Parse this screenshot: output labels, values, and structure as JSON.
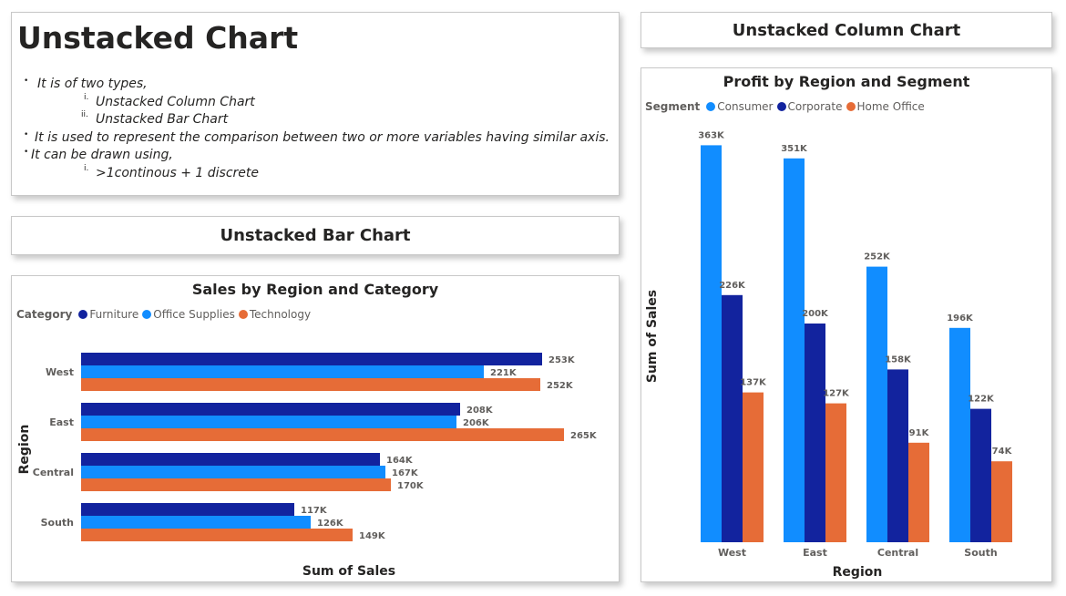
{
  "notes": {
    "title": "Unstacked Chart",
    "lines": [
      {
        "marker": "•",
        "text": "It is of two types,"
      },
      {
        "marker": "i.",
        "text": "Unstacked Column Chart"
      },
      {
        "marker": "ii.",
        "text": "Unstacked Bar Chart"
      },
      {
        "marker": "•",
        "text": "It is used to represent the comparison between two or more variables having similar axis."
      },
      {
        "marker": "•",
        "text": "It can be drawn using,"
      },
      {
        "marker": "i.",
        "text": ">1continous + 1 discrete"
      }
    ]
  },
  "bar_section_title": "Unstacked Bar Chart",
  "column_section_title": "Unstacked Column Chart",
  "colors": {
    "dark_blue": "#12239e",
    "light_blue": "#118dff",
    "orange": "#e66c37"
  },
  "chart_data": [
    {
      "type": "bar",
      "orientation": "horizontal",
      "title": "Sales by Region and Category",
      "legend_title": "Category",
      "legend_position": "top-left",
      "categories": [
        "West",
        "East",
        "Central",
        "South"
      ],
      "series": [
        {
          "name": "Furniture",
          "color": "#12239e",
          "values": [
            253,
            208,
            164,
            117
          ],
          "labels": [
            "253K",
            "208K",
            "164K",
            "117K"
          ]
        },
        {
          "name": "Office Supplies",
          "color": "#118dff",
          "values": [
            221,
            206,
            167,
            126
          ],
          "labels": [
            "221K",
            "206K",
            "167K",
            "126K"
          ]
        },
        {
          "name": "Technology",
          "color": "#e66c37",
          "values": [
            252,
            265,
            170,
            149
          ],
          "labels": [
            "252K",
            "265K",
            "170K",
            "149K"
          ]
        }
      ],
      "xlabel": "Sum of Sales",
      "ylabel": "Region",
      "xlim": [
        0,
        270
      ],
      "grid": false
    },
    {
      "type": "bar",
      "orientation": "vertical",
      "title": "Profit by Region and Segment",
      "legend_title": "Segment",
      "legend_position": "top-left",
      "categories": [
        "West",
        "East",
        "Central",
        "South"
      ],
      "series": [
        {
          "name": "Consumer",
          "color": "#118dff",
          "values": [
            363,
            351,
            252,
            196
          ],
          "labels": [
            "363K",
            "351K",
            "252K",
            "196K"
          ]
        },
        {
          "name": "Corporate",
          "color": "#12239e",
          "values": [
            226,
            200,
            158,
            122
          ],
          "labels": [
            "226K",
            "200K",
            "158K",
            "122K"
          ]
        },
        {
          "name": "Home Office",
          "color": "#e66c37",
          "values": [
            137,
            127,
            91,
            74
          ],
          "labels": [
            "137K",
            "127K",
            "91K",
            "74K"
          ]
        }
      ],
      "xlabel": "Region",
      "ylabel": "Sum of Sales",
      "ylim": [
        0,
        363
      ],
      "grid": false
    }
  ]
}
